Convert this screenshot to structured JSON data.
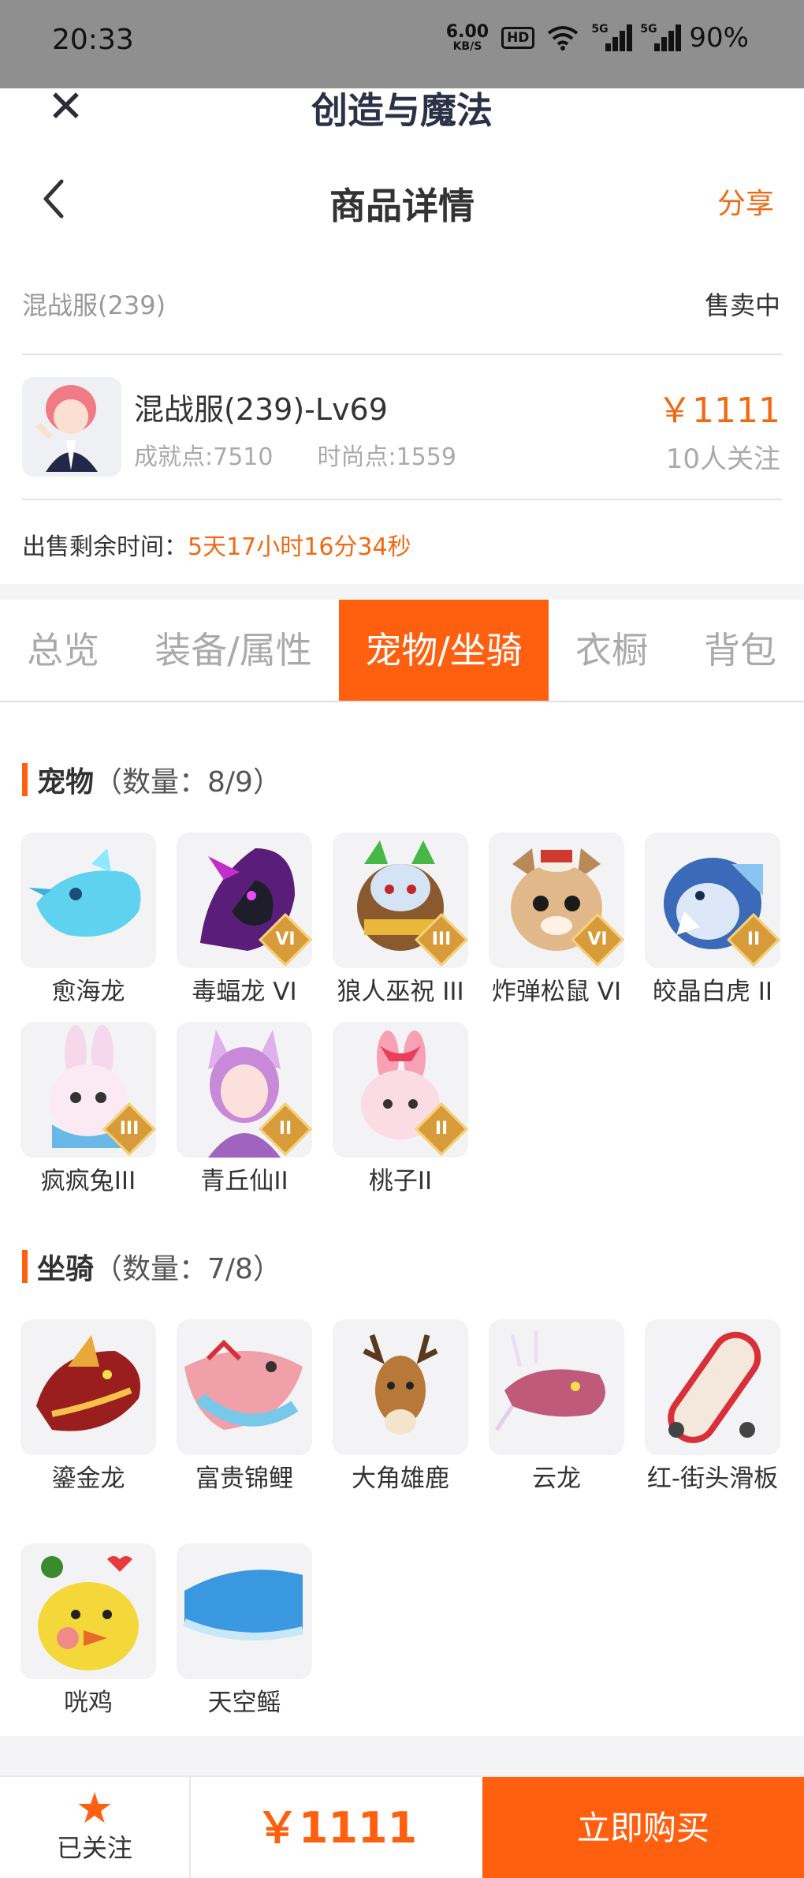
{
  "status_bar": {
    "time": "20:33",
    "net_speed_value": "6.00",
    "net_speed_unit": "KB/S",
    "hd_label": "HD",
    "signal1_label": "5G",
    "signal2_label": "5G",
    "battery": "90%"
  },
  "app": {
    "title": "创造与魔法",
    "close_icon": "close-icon"
  },
  "navbar": {
    "title": "商品详情",
    "share": "分享",
    "back_icon": "chevron-left-icon"
  },
  "info": {
    "server": "混战服(239)",
    "status": "售卖中",
    "role_name": "混战服(239)-Lv69",
    "achievement": "成就点:7510",
    "fashion": "时尚点:1559",
    "price": "￥1111",
    "follows": "10人关注",
    "remain_label": "出售剩余时间：",
    "remain_value": "5天17小时16分34秒"
  },
  "tabs": [
    "总览",
    "装备/属性",
    "宠物/坐骑",
    "衣橱",
    "背包"
  ],
  "active_tab": "宠物/坐骑",
  "pets": {
    "title": "宠物",
    "count": "（数量：8/9）",
    "items": [
      {
        "name": "愈海龙",
        "badge": ""
      },
      {
        "name": "毒蝠龙 VI",
        "badge": "VI"
      },
      {
        "name": "狼人巫祝 III",
        "badge": "III"
      },
      {
        "name": "炸弹松鼠 VI",
        "badge": "VI"
      },
      {
        "name": "皎晶白虎 II",
        "badge": "II"
      },
      {
        "name": "疯疯兔III",
        "badge": "III"
      },
      {
        "name": "青丘仙II",
        "badge": "II"
      },
      {
        "name": "桃子II",
        "badge": "II"
      }
    ]
  },
  "mounts": {
    "title": "坐骑",
    "count": "（数量：7/8）",
    "items": [
      {
        "name": "鎏金龙"
      },
      {
        "name": "富贵锦鲤"
      },
      {
        "name": "大角雄鹿"
      },
      {
        "name": "云龙"
      },
      {
        "name": "红-街头滑板"
      },
      {
        "name": "咣鸡"
      },
      {
        "name": "天空鳐"
      }
    ]
  },
  "bottom": {
    "follow_label": "已关注",
    "price": "￥1111",
    "buy_label": "立即购买"
  },
  "colors": {
    "accent": "#ff6010",
    "price": "#f06a14"
  }
}
